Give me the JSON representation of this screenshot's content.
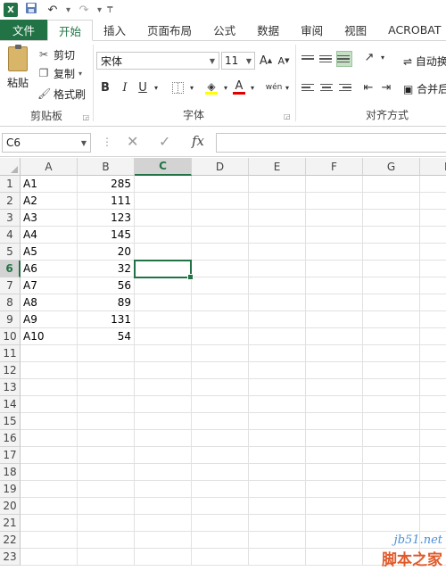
{
  "qat": {
    "app_icon": "X",
    "undo": "↶",
    "redo": "↷",
    "customize": "₸"
  },
  "tabs": [
    {
      "label": "文件"
    },
    {
      "label": "开始"
    },
    {
      "label": "插入"
    },
    {
      "label": "页面布局"
    },
    {
      "label": "公式"
    },
    {
      "label": "数据"
    },
    {
      "label": "审阅"
    },
    {
      "label": "视图"
    },
    {
      "label": "ACROBAT"
    }
  ],
  "ribbon": {
    "clipboard": {
      "paste": "粘贴",
      "cut": "剪切",
      "copy": "复制",
      "format_painter": "格式刷",
      "label": "剪贴板"
    },
    "font": {
      "name": "宋体",
      "size": "11",
      "label": "字体",
      "bold": "B",
      "italic": "I",
      "underline": "U",
      "grow": "A",
      "shrink": "A",
      "color_a": "A",
      "phonetic": "wén"
    },
    "alignment": {
      "wrap_text": "自动换",
      "merge": "合并后",
      "label": "对齐方式"
    }
  },
  "formula_bar": {
    "name_box": "C6",
    "fx": "fx",
    "cancel": "✕",
    "enter": "✓",
    "more": "⋮",
    "value": ""
  },
  "sheet": {
    "columns": [
      "A",
      "B",
      "C",
      "D",
      "E",
      "F",
      "G",
      "H"
    ],
    "selected_column": "C",
    "selected_row": 6,
    "rows": [
      {
        "n": "1",
        "a": "A1",
        "b": "285"
      },
      {
        "n": "2",
        "a": "A2",
        "b": "111"
      },
      {
        "n": "3",
        "a": "A3",
        "b": "123"
      },
      {
        "n": "4",
        "a": "A4",
        "b": "145"
      },
      {
        "n": "5",
        "a": "A5",
        "b": "20"
      },
      {
        "n": "6",
        "a": "A6",
        "b": "32"
      },
      {
        "n": "7",
        "a": "A7",
        "b": "56"
      },
      {
        "n": "8",
        "a": "A8",
        "b": "89"
      },
      {
        "n": "9",
        "a": "A9",
        "b": "131"
      },
      {
        "n": "10",
        "a": "A10",
        "b": "54"
      },
      {
        "n": "11",
        "a": "",
        "b": ""
      },
      {
        "n": "12",
        "a": "",
        "b": ""
      },
      {
        "n": "13",
        "a": "",
        "b": ""
      },
      {
        "n": "14",
        "a": "",
        "b": ""
      },
      {
        "n": "15",
        "a": "",
        "b": ""
      },
      {
        "n": "16",
        "a": "",
        "b": ""
      },
      {
        "n": "17",
        "a": "",
        "b": ""
      },
      {
        "n": "18",
        "a": "",
        "b": ""
      },
      {
        "n": "19",
        "a": "",
        "b": ""
      },
      {
        "n": "20",
        "a": "",
        "b": ""
      },
      {
        "n": "21",
        "a": "",
        "b": ""
      },
      {
        "n": "22",
        "a": "",
        "b": ""
      },
      {
        "n": "23",
        "a": "",
        "b": ""
      }
    ]
  },
  "watermark": {
    "line1": "jb51.net",
    "line2": "脚本之家"
  },
  "colors": {
    "accent": "#217346",
    "selection": "#217346"
  }
}
